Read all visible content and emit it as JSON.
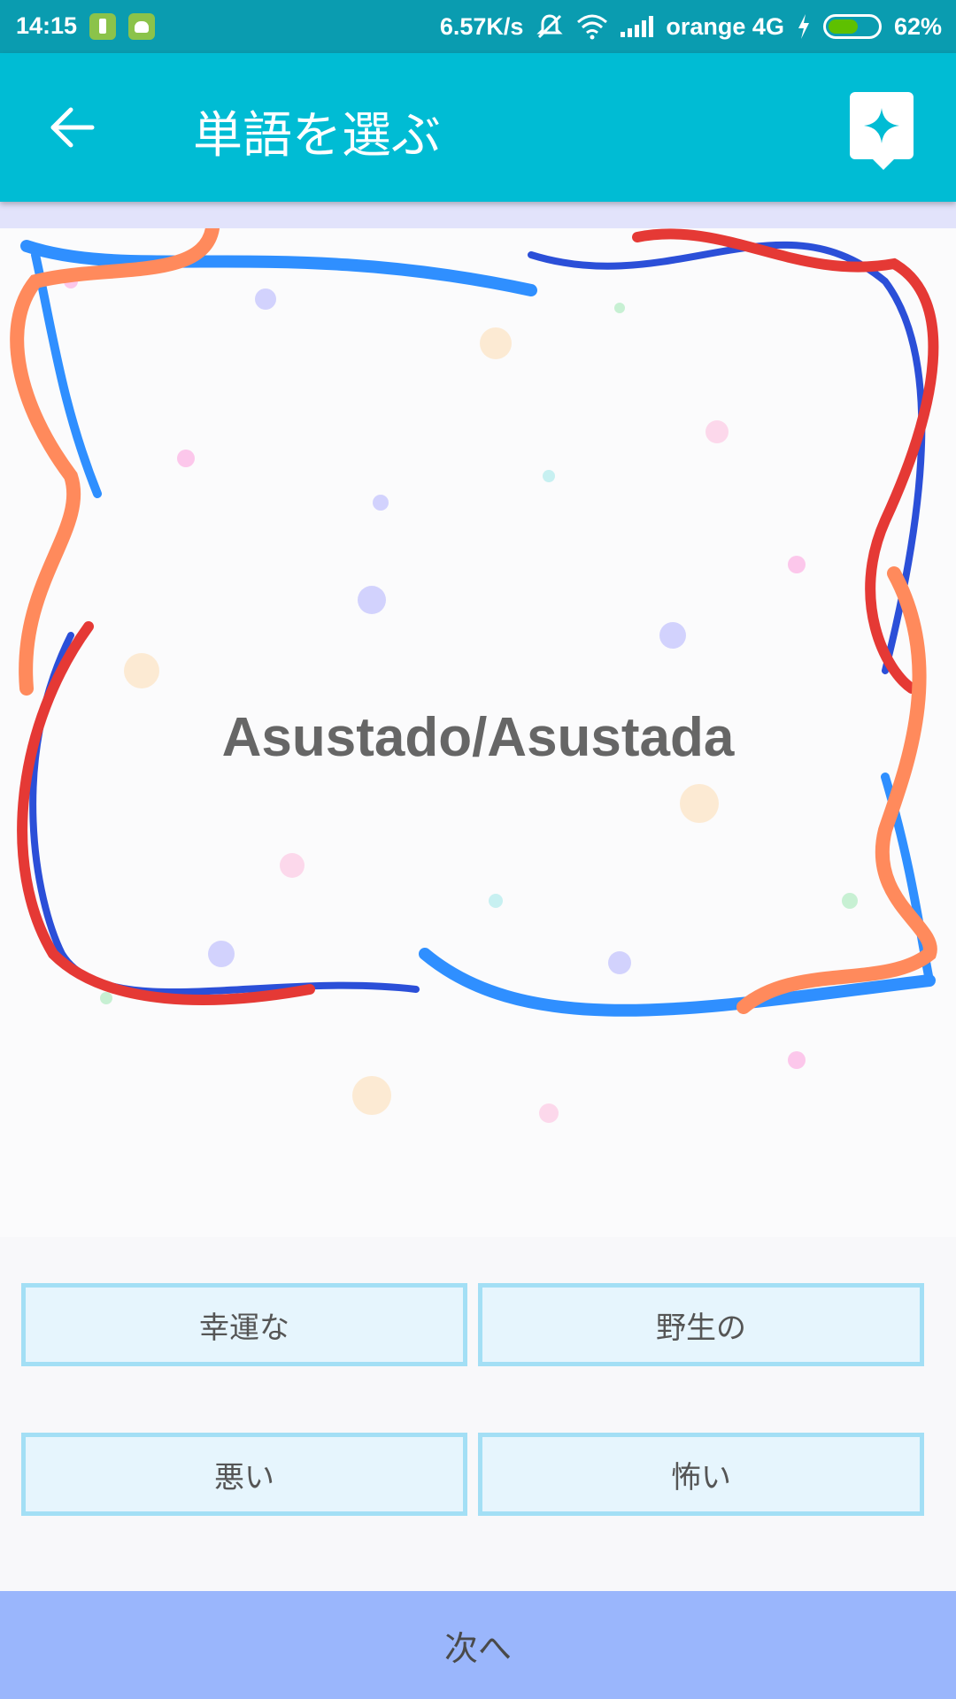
{
  "status_bar": {
    "time": "14:15",
    "net_speed": "6.57K/s",
    "carrier": "orange 4G",
    "battery_percent": "62%",
    "battery_level": 0.62
  },
  "app_bar": {
    "title": "単語を選ぶ",
    "back_icon": "arrow-left-icon",
    "favorite_icon": "sparkle-bookmark-icon"
  },
  "card": {
    "word": "Asustado/Asustada"
  },
  "options": [
    {
      "label": "幸運な"
    },
    {
      "label": "野生の"
    },
    {
      "label": "悪い"
    },
    {
      "label": "怖い"
    }
  ],
  "next_button": {
    "label": "次へ"
  },
  "colors": {
    "status_bar": "#0a9cb0",
    "app_bar": "#00bcd4",
    "option_bg": "#e6f5fd",
    "option_border": "#a3dff5",
    "next_bar": "#9ab6fc"
  }
}
